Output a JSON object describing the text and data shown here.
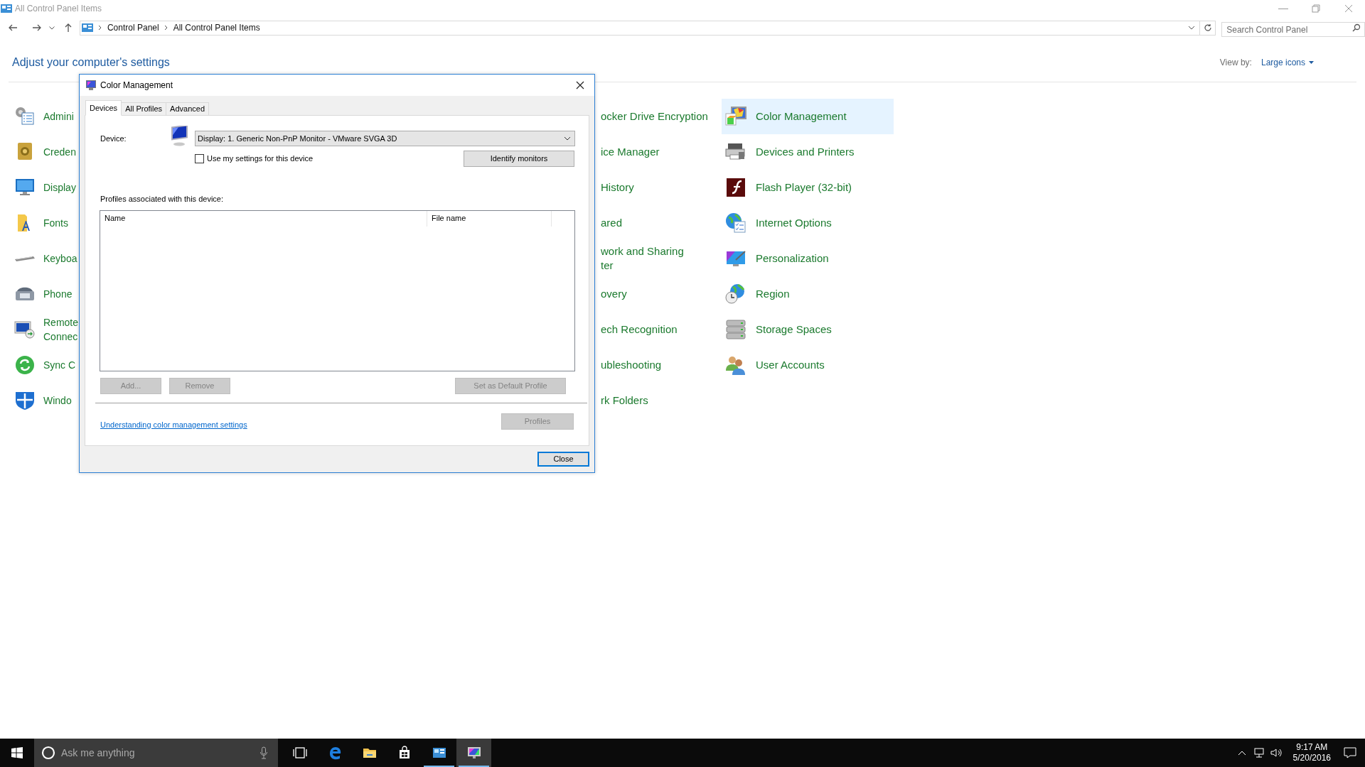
{
  "window": {
    "title": "All Control Panel Items"
  },
  "address_bar": {
    "path": [
      "Control Panel",
      "All Control Panel Items"
    ]
  },
  "search": {
    "placeholder": "Search Control Panel"
  },
  "heading": "Adjust your computer's settings",
  "view_by": {
    "label": "View by:",
    "value": "Large icons"
  },
  "columns": [
    [
      {
        "lines": [
          "Admini"
        ],
        "selected": false
      },
      {
        "lines": [
          "Creden"
        ],
        "selected": false
      },
      {
        "lines": [
          "Display"
        ],
        "selected": false
      },
      {
        "lines": [
          "Fonts"
        ],
        "selected": false
      },
      {
        "lines": [
          "Keyboa"
        ],
        "selected": false
      },
      {
        "lines": [
          "Phone"
        ],
        "selected": false
      },
      {
        "lines": [
          "Remote",
          "Connec"
        ],
        "selected": false
      },
      {
        "lines": [
          "Sync C"
        ],
        "selected": false
      },
      {
        "lines": [
          "Windo"
        ],
        "selected": false
      }
    ],
    [
      {
        "lines": [
          "ocker Drive Encryption"
        ],
        "selected": false
      },
      {
        "lines": [
          "ice Manager"
        ],
        "selected": false
      },
      {
        "lines": [
          "History"
        ],
        "selected": false
      },
      {
        "lines": [
          "ared"
        ],
        "selected": false
      },
      {
        "lines": [
          "work and Sharing",
          "ter"
        ],
        "selected": false
      },
      {
        "lines": [
          "overy"
        ],
        "selected": false
      },
      {
        "lines": [
          "ech Recognition"
        ],
        "selected": false
      },
      {
        "lines": [
          "ubleshooting"
        ],
        "selected": false
      },
      {
        "lines": [
          "rk Folders"
        ],
        "selected": false
      }
    ],
    [
      {
        "lines": [
          "Color Management"
        ],
        "selected": true
      },
      {
        "lines": [
          "Devices and Printers"
        ],
        "selected": false
      },
      {
        "lines": [
          "Flash Player (32-bit)"
        ],
        "selected": false
      },
      {
        "lines": [
          "Internet Options"
        ],
        "selected": false
      },
      {
        "lines": [
          "Personalization"
        ],
        "selected": false
      },
      {
        "lines": [
          "Region"
        ],
        "selected": false
      },
      {
        "lines": [
          "Storage Spaces"
        ],
        "selected": false
      },
      {
        "lines": [
          "User Accounts"
        ],
        "selected": false
      }
    ]
  ],
  "dialog": {
    "title": "Color Management",
    "tabs": [
      {
        "label": "Devices",
        "selected": true
      },
      {
        "label": "All Profiles",
        "selected": false
      },
      {
        "label": "Advanced",
        "selected": false
      }
    ],
    "device_label": "Device:",
    "device_value": "Display: 1. Generic Non-PnP Monitor - VMware SVGA 3D",
    "use_my_settings": {
      "label": "Use my settings for this device",
      "checked": false
    },
    "identify_button": {
      "label": "Identify monitors",
      "disabled": false
    },
    "profiles_label": "Profiles associated with this device:",
    "profile_columns": [
      "Name",
      "File name"
    ],
    "profile_buttons": [
      {
        "label": "Add...",
        "disabled": true
      },
      {
        "label": "Remove",
        "disabled": true
      },
      {
        "label": "Set as Default Profile",
        "disabled": true
      }
    ],
    "link": "Understanding color management settings",
    "profiles_button": {
      "label": "Profiles",
      "disabled": true
    },
    "close_button": "Close"
  },
  "taskbar": {
    "search_placeholder": "Ask me anything",
    "apps": [
      {
        "running": false,
        "active": false
      },
      {
        "running": false,
        "active": false
      },
      {
        "running": false,
        "active": false
      },
      {
        "running": false,
        "active": false
      },
      {
        "running": true,
        "active": false
      },
      {
        "running": true,
        "active": true
      }
    ],
    "time": "9:17 AM",
    "date": "5/20/2016"
  }
}
